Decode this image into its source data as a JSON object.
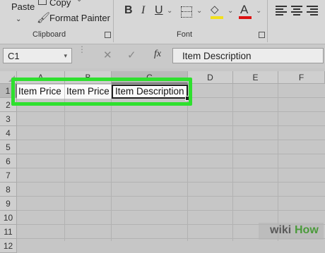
{
  "ribbon": {
    "clipboard": {
      "paste_label": "Paste",
      "copy_label": "Copy",
      "format_painter_label": "Format Painter",
      "group_label": "Clipboard"
    },
    "font": {
      "bold": "B",
      "italic": "I",
      "underline": "U",
      "font_color_glyph": "A",
      "group_label": "Font",
      "fill_color": "#f2e01c",
      "font_color": "#dd1111"
    }
  },
  "formula_bar": {
    "name_box": "C1",
    "fx_label": "fx",
    "content": "Item Description"
  },
  "sheet": {
    "columns": [
      "A",
      "B",
      "C",
      "D",
      "E",
      "F"
    ],
    "selected_column": "C",
    "rows": [
      "1",
      "2",
      "3",
      "4",
      "5",
      "6",
      "7",
      "8",
      "9",
      "10",
      "11",
      "12"
    ],
    "row1": {
      "A": "Item Price",
      "B": "Item Price",
      "C": "Item Description"
    },
    "highlight_color": "#2ee02e"
  },
  "watermark": {
    "wiki": "wiki",
    "how": "How"
  }
}
